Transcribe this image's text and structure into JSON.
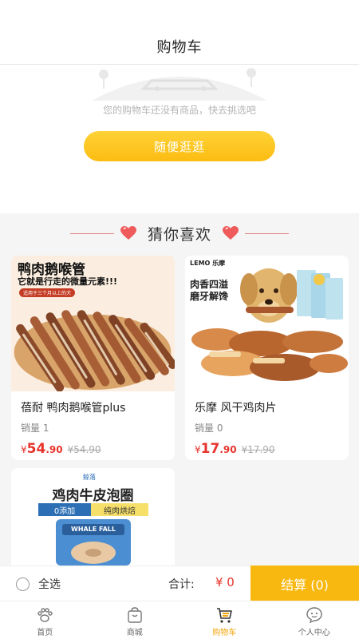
{
  "header": {
    "title": "购物车"
  },
  "empty_state": {
    "message": "您的购物车还没有商品，快去挑选吧",
    "browse_label": "随便逛逛"
  },
  "recommend": {
    "title": "猜你喜欢",
    "products": [
      {
        "name": "蓓耐 鸭肉鹅喉管plus",
        "sales": "销量 1",
        "currency": "¥",
        "price_int": "54",
        "price_dec": ".90",
        "old_price": "¥54.90",
        "image": {
          "headline": "鸭肉鹅喉管",
          "subline": "它就是行走的微量元素!!!",
          "tag": "适用于三个月以上的犬"
        }
      },
      {
        "name": "乐摩 风干鸡肉片",
        "sales": "销量 0",
        "currency": "¥",
        "price_int": "17",
        "price_dec": ".90",
        "old_price": "¥17.90",
        "image": {
          "brand": "LEMO 乐摩",
          "slogan_1": "肉香四溢",
          "slogan_2": "磨牙解馋"
        }
      },
      {
        "image": {
          "brand": "鲸落",
          "headline": "鸡肉牛皮泡圈",
          "tag_left": "0添加",
          "tag_right": "纯肉烘焙",
          "pack_text": "WHALE FALL"
        }
      }
    ]
  },
  "checkout": {
    "select_all": "全选",
    "total_label": "合计:",
    "total_value": "¥ 0",
    "button_label": "结算 (0)"
  },
  "tabbar": {
    "items": [
      {
        "label": "首页",
        "icon": "paw-icon"
      },
      {
        "label": "商城",
        "icon": "shop-bag-icon"
      },
      {
        "label": "购物车",
        "icon": "cart-icon"
      },
      {
        "label": "个人中心",
        "icon": "user-chat-icon"
      }
    ],
    "active": "购物车"
  },
  "colors": {
    "accent": "#f9b80f",
    "price": "#e8332c",
    "heart": "#ef5b5b"
  }
}
